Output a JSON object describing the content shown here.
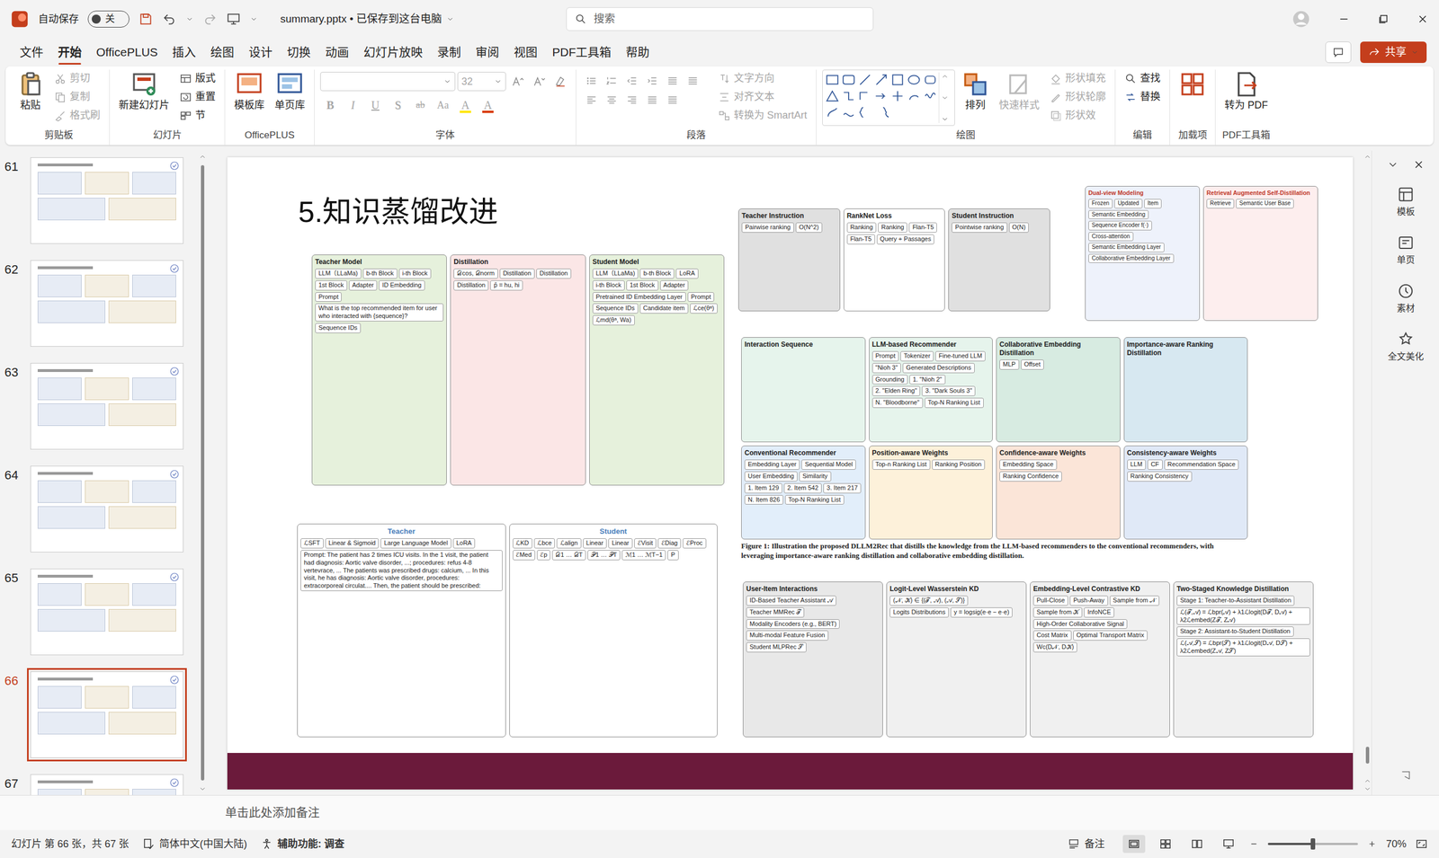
{
  "window": {
    "autosave": {
      "label": "自动保存",
      "on": false,
      "state": "关"
    },
    "title": "summary.pptx • 已保存到这台电脑",
    "search": {
      "placeholder": "搜索"
    }
  },
  "menu": {
    "tabs": [
      {
        "label": "文件",
        "selected": false
      },
      {
        "label": "开始",
        "selected": true
      },
      {
        "label": "OfficePLUS",
        "selected": false
      },
      {
        "label": "插入",
        "selected": false
      },
      {
        "label": "绘图",
        "selected": false
      },
      {
        "label": "设计",
        "selected": false
      },
      {
        "label": "切换",
        "selected": false
      },
      {
        "label": "动画",
        "selected": false
      },
      {
        "label": "幻灯片放映",
        "selected": false
      },
      {
        "label": "录制",
        "selected": false
      },
      {
        "label": "审阅",
        "selected": false
      },
      {
        "label": "视图",
        "selected": false
      },
      {
        "label": "PDF工具箱",
        "selected": false
      },
      {
        "label": "帮助",
        "selected": false
      }
    ],
    "share": "共享"
  },
  "ribbon": {
    "groups": [
      {
        "title": "剪贴板",
        "kind": "standard",
        "items": [
          {
            "kind": "large",
            "label": "粘贴",
            "disabled": false
          },
          {
            "kind": "small",
            "label": "剪切",
            "disabled": true
          },
          {
            "kind": "small",
            "label": "复制",
            "disabled": true
          },
          {
            "kind": "small",
            "label": "格式刷",
            "disabled": true
          }
        ]
      },
      {
        "title": "幻灯片",
        "kind": "standard",
        "items": [
          {
            "kind": "large",
            "label": "新建幻灯片",
            "disabled": false
          },
          {
            "kind": "small",
            "label": "版式",
            "disabled": false
          },
          {
            "kind": "small",
            "label": "重置",
            "disabled": false
          },
          {
            "kind": "small",
            "label": "节",
            "disabled": false
          }
        ]
      },
      {
        "title": "OfficePLUS",
        "kind": "standard",
        "items": [
          {
            "kind": "large",
            "label": "模板库",
            "disabled": false
          },
          {
            "kind": "large",
            "label": "单页库",
            "disabled": false
          }
        ]
      },
      {
        "title": "字体",
        "kind": "font",
        "items": [
          {
            "kind": "fontname",
            "disabled": true
          },
          {
            "kind": "fontsize",
            "label": "32",
            "disabled": true
          },
          {
            "kind": "icon",
            "disabled": true
          },
          {
            "kind": "icon",
            "disabled": true
          },
          {
            "kind": "icon",
            "disabled": true
          },
          {
            "kind": "glyph",
            "label": "B",
            "disabled": true
          },
          {
            "kind": "glyph",
            "label": "I",
            "disabled": true
          },
          {
            "kind": "glyph",
            "label": "U",
            "disabled": true
          },
          {
            "kind": "glyph",
            "label": "S",
            "disabled": true
          },
          {
            "kind": "glyph",
            "label": "ab",
            "disabled": true
          },
          {
            "kind": "glyph",
            "label": "Aa",
            "disabled": true
          },
          {
            "kind": "glyph",
            "label": "A",
            "disabled": true
          },
          {
            "kind": "glyph",
            "label": "A",
            "disabled": true
          }
        ]
      },
      {
        "title": "段落",
        "kind": "paragraph",
        "items": [
          {
            "kind": "icon",
            "disabled": true
          },
          {
            "kind": "icon",
            "disabled": true
          },
          {
            "kind": "icon",
            "disabled": true
          },
          {
            "kind": "icon",
            "disabled": true
          },
          {
            "kind": "icon",
            "disabled": true
          },
          {
            "kind": "icon",
            "disabled": true
          },
          {
            "kind": "icon",
            "disabled": true
          },
          {
            "kind": "icon",
            "disabled": true
          },
          {
            "kind": "icon",
            "disabled": true
          },
          {
            "kind": "icon",
            "disabled": true
          },
          {
            "kind": "icon",
            "disabled": true
          },
          {
            "kind": "small",
            "label": "文字方向",
            "disabled": true
          },
          {
            "kind": "small",
            "label": "对齐文本",
            "disabled": true
          },
          {
            "kind": "small",
            "label": "转换为 SmartArt",
            "disabled": true
          }
        ]
      },
      {
        "title": "绘图",
        "kind": "drawing",
        "items": [
          {
            "kind": "gallery",
            "disabled": false
          },
          {
            "kind": "large",
            "label": "排列",
            "disabled": false
          },
          {
            "kind": "large",
            "label": "快速样式",
            "disabled": true
          },
          {
            "kind": "small",
            "label": "形状填充",
            "disabled": true
          },
          {
            "kind": "small",
            "label": "形状轮廓",
            "disabled": true
          },
          {
            "kind": "small",
            "label": "形状效",
            "disabled": true
          }
        ]
      },
      {
        "title": "编辑",
        "kind": "standard",
        "items": [
          {
            "kind": "small",
            "label": "查找",
            "disabled": false
          },
          {
            "kind": "small",
            "label": "替换",
            "disabled": false
          }
        ]
      },
      {
        "title": "加载项",
        "kind": "standard",
        "items": [
          {
            "kind": "iconlarge",
            "disabled": false
          }
        ]
      },
      {
        "title": "PDF工具箱",
        "kind": "standard",
        "items": [
          {
            "kind": "large",
            "label": "转为 PDF",
            "disabled": false
          }
        ]
      }
    ]
  },
  "thumbnails": [
    {
      "number": "61",
      "selected": false
    },
    {
      "number": "62",
      "selected": false
    },
    {
      "number": "63",
      "selected": false
    },
    {
      "number": "64",
      "selected": false
    },
    {
      "number": "65",
      "selected": false
    },
    {
      "number": "66",
      "selected": true
    },
    {
      "number": "67",
      "selected": false
    }
  ],
  "slide": {
    "title": "5.知识蒸馏改进",
    "figures": [
      {
        "panels": [
          {
            "title": "Teacher Model",
            "color": "#e6f1dc",
            "labels": [
              "LLM（LLaMa)",
              "b-th Block",
              "i-th Block",
              "1st Block",
              "Adapter",
              "ID Embedding",
              "Prompt",
              "What is the top recommended item for user who interacted with {sequence}?",
              "Sequence IDs"
            ]
          },
          {
            "title": "Distillation",
            "color": "#fbe6e6",
            "labels": [
              "𝒟cos, 𝒟norm",
              "Distillation",
              "Distillation",
              "Distillation",
              "p̂ = hu, hi"
            ]
          },
          {
            "title": "Student Model",
            "color": "#e6f1dc",
            "labels": [
              "LLM（LLaMa)",
              "b-th Block",
              "LoRA",
              "i-th Block",
              "1st Block",
              "Adapter",
              "Pretrained ID Embedding Layer",
              "Prompt",
              "Sequence IDs",
              "Candidate item",
              "ℒce(θᵃ)",
              "ℒmd(θᵃ, Wa)"
            ]
          }
        ]
      },
      {
        "panels": [
          {
            "title": "Teacher Instruction",
            "color": "#e0e0e0",
            "labels": [
              "Pairwise ranking",
              "O(N^2)"
            ]
          },
          {
            "title": "RankNet Loss",
            "color": "#ffffff",
            "labels": [
              "Ranking",
              "Ranking",
              "Flan-T5",
              "Flan-T5",
              "Query + Passages"
            ]
          },
          {
            "title": "Student Instruction",
            "color": "#e0e0e0",
            "labels": [
              "Pointwise ranking",
              "O(N)"
            ]
          }
        ]
      },
      {
        "panels": [
          {
            "title": "Dual-view Modeling",
            "color": "#eef2fb",
            "labels": [
              "Frozen",
              "Updated",
              "Item",
              "Semantic Embedding",
              "Sequence Encoder f(·)",
              "Cross-attention",
              "Semantic Embedding Layer",
              "Collaborative Embedding Layer"
            ]
          },
          {
            "title": "Retrieval Augmented Self-Distillation",
            "color": "#fdeeee",
            "labels": [
              "Retrieve",
              "Semantic User Base"
            ]
          }
        ]
      },
      {
        "caption": "Figure 1: Illustration the proposed DLLM2Rec that distills the knowledge from the LLM-based recommenders to the conventional recommenders, with leveraging importance-aware ranking distillation and collaborative embedding distillation.",
        "panels": [
          {
            "title": "Interaction Sequence",
            "color": "#e6f4ec",
            "labels": []
          },
          {
            "title": "LLM-based Recommender",
            "color": "#e6f4ec",
            "labels": [
              "Prompt",
              "Tokenizer",
              "Fine-tuned LLM",
              "\"Nioh 3\"",
              "Generated Descriptions",
              "Grounding",
              "1. \"Nioh 2\"",
              "2. \"Elden Ring\"",
              "3. \"Dark Souls 3\"",
              "N. \"Bloodborne\"",
              "Top-N Ranking List"
            ]
          },
          {
            "title": "Collaborative Embedding Distillation",
            "color": "#d7ebe1",
            "labels": [
              "MLP",
              "Offset"
            ]
          },
          {
            "title": "Importance-aware Ranking Distillation",
            "color": "#d7e8f1",
            "labels": []
          },
          {
            "title": "Conventional Recommender",
            "color": "#e2eefa",
            "labels": [
              "Embedding Layer",
              "Sequential Model",
              "User Embedding",
              "Similarity",
              "1. Item 129",
              "2. Item 542",
              "3. Item 217",
              "N. Item 826",
              "Top-N Ranking List"
            ]
          },
          {
            "title": "Position-aware Weights",
            "color": "#fdf1da",
            "labels": [
              "Top-n Ranking List",
              "Ranking Position"
            ]
          },
          {
            "title": "Confidence-aware Weights",
            "color": "#fbe5d8",
            "labels": [
              "Embedding Space",
              "Ranking Confidence"
            ]
          },
          {
            "title": "Consistency-aware Weights",
            "color": "#e0e9f7",
            "labels": [
              "LLM",
              "CF",
              "Recommendation Space",
              "Ranking Consistency"
            ]
          }
        ]
      },
      {
        "panels": [
          {
            "title": "Teacher",
            "color": "#ffffff",
            "labels": [
              "ℒSFT",
              "Linear & Sigmoid",
              "Large Language Model",
              "LoRA",
              "Prompt: The patient has 2 times ICU visits. In the 1 visit, the patient had diagnosis: Aortic valve disorder, ...; procedures: refus 4-8 vertevrace, ... The patients was prescribed drugs: calcium, ... In this visit, he has diagnosis: Aortic valve disorder, procedures: extracorporeal circulat.... Then, the patient should be prescribed:"
            ]
          },
          {
            "title": "Student",
            "color": "#ffffff",
            "labels": [
              "ℒKD",
              "ℒbce",
              "ℒalign",
              "Linear",
              "Linear",
              "ℰVisit",
              "ℰDiag",
              "ℰProc",
              "ℰMed",
              "ℰp",
              "𝒟1 … 𝒟T",
              "𝒫1 … 𝒫T",
              "ℳ1 … ℳT−1",
              "P"
            ]
          }
        ]
      },
      {
        "panels": [
          {
            "title": "User-Item Interactions",
            "color": "#e8e8e8",
            "labels": [
              "ID-Based Teacher Assistant 𝒜",
              "Teacher MMRec 𝒯",
              "Modality Encoders (e.g., BERT)",
              "Multi-modal Feature Fusion",
              "Student MLPRec 𝒮"
            ]
          },
          {
            "title": "Logit-Level Wasserstein KD",
            "color": "#f0f0f0",
            "labels": [
              "(𝒩, 𝒦) ∈ {(𝒯, 𝒜), (𝒜, 𝒮)}",
              "Logits Distributions",
              "y = logsig(e·e − e·e)"
            ]
          },
          {
            "title": "Embedding-Level Contrastive KD",
            "color": "#f0f0f0",
            "labels": [
              "Pull-Close",
              "Push-Away",
              "Sample from 𝒩",
              "Sample from 𝒦",
              "InfoNCE",
              "High-Order Collaborative Signal",
              "Cost Matrix",
              "Optimal Transport Matrix",
              "Wc(D𝒩, D𝒦)"
            ]
          },
          {
            "title": "Two-Staged Knowledge Distillation",
            "color": "#f0f0f0",
            "labels": [
              "Stage 1: Teacher-to-Assistant Distillation",
              "ℒ(𝒯,𝒜) = ℒbpr(𝒜) + λ1ℒlogit(D𝒯, D𝒜) + λ2ℒembed(Z𝒯, Z𝒜)",
              "Stage 2: Assistant-to-Student Distillation",
              "ℒ(𝒜,𝒮) = ℒbpr(𝒮) + λ1ℒlogit(D𝒜, D𝒮) + λ2ℒembed(Z𝒜, Z𝒮)"
            ]
          }
        ]
      }
    ]
  },
  "notes": {
    "placeholder": "单击此处添加备注"
  },
  "taskpane": {
    "items": [
      "模板",
      "单页",
      "素材",
      "全文美化"
    ]
  },
  "status": {
    "slide": "幻灯片 第 66 张，共 67 张",
    "language": "简体中文(中国大陆)",
    "accessibility": "辅助功能: 调查",
    "notes": "备注",
    "views": [
      {
        "selected": true
      },
      {
        "selected": false
      },
      {
        "selected": false
      },
      {
        "selected": false
      }
    ],
    "zoom": {
      "level": 0.5,
      "reading": "70%"
    }
  }
}
